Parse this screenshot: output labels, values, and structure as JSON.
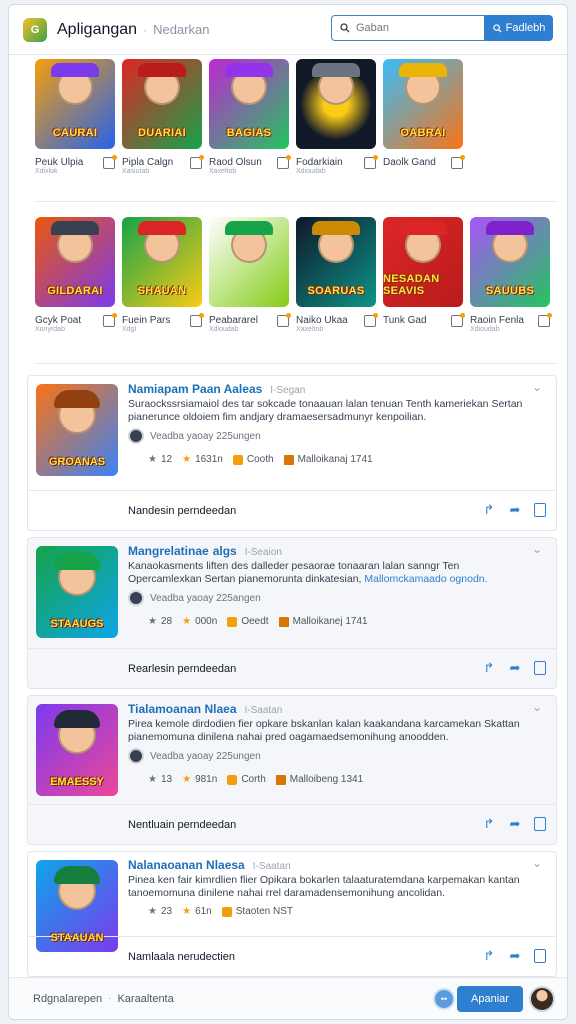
{
  "header": {
    "logo_text": "G",
    "app_title": "Apligangan",
    "separator": "·",
    "subtitle": "Nedarkan",
    "search_placeholder": "Gaban",
    "search_button": "Fadlebh"
  },
  "grid_row_1": [
    {
      "banner": "CAURAI",
      "name": "Peuk Ulpia",
      "sub": "Xdixlok",
      "bg": "linear-gradient(135deg,#f59e0b,#2563eb)",
      "accent": "#7c3aed"
    },
    {
      "banner": "DUARIAI",
      "name": "Pipla Calgn",
      "sub": "Xasiutab",
      "bg": "linear-gradient(135deg,#dc2626,#16a34a)",
      "accent": "#b91c1c"
    },
    {
      "banner": "BAGIAS",
      "name": "Raod Olsun",
      "sub": "Xaxeltob",
      "bg": "linear-gradient(135deg,#c026d3,#22c55e)",
      "accent": "#9333ea"
    },
    {
      "banner": "",
      "name": "Fodarkiain",
      "sub": "Xdioudab",
      "bg": "radial-gradient(circle,#facc15 20%,#111827 60%)",
      "accent": "#6b7280"
    },
    {
      "banner": "OABRAI",
      "name": "Daolk Gand",
      "sub": "",
      "bg": "linear-gradient(135deg,#38bdf8,#f97316)",
      "accent": "#eab308"
    }
  ],
  "grid_row_2": [
    {
      "banner": "GILDARAI",
      "name": "Gcyk Poat",
      "sub": "Xonyrdab",
      "bg": "linear-gradient(135deg,#ea580c,#7c3aed)",
      "accent": "#374151"
    },
    {
      "banner": "SHAUAN",
      "name": "Fuein Pars",
      "sub": "Xdgl",
      "bg": "linear-gradient(135deg,#16a34a,#facc15)",
      "accent": "#dc2626"
    },
    {
      "banner": "",
      "name": "Peabararel",
      "sub": "Xdioudab",
      "bg": "linear-gradient(135deg,#ffffff,#84cc16)",
      "accent": "#16a34a"
    },
    {
      "banner": "SOARUAS",
      "name": "Naiko Ukaa",
      "sub": "Xaxeltob",
      "bg": "linear-gradient(135deg,#0f172a,#0d9488)",
      "accent": "#ca8a04"
    },
    {
      "banner": "NESADAN SEAVIS",
      "name": "Tunk Gad",
      "sub": "",
      "bg": "linear-gradient(135deg,#dc2626,#b91c1c)",
      "accent": "#dc2626"
    },
    {
      "banner": "SAUUBS",
      "name": "Raoin Fenla",
      "sub": "Xdioudab",
      "bg": "linear-gradient(135deg,#a855f7,#22c55e)",
      "accent": "#7e22ce"
    }
  ],
  "cards": [
    {
      "title": "Namiapam Paan Aaleas",
      "tag": "I-Segan",
      "desc": "Suraockssrsiamaiol des tar sokcade tonaauan lalan tenuan Tenth kameriekan Sertan pianerunce oldoiem fim andjary dramaesersadmunyr kenpoilian.",
      "desc_link": "",
      "author": "Veadba yaoay 225ungen",
      "stat_1": "12",
      "stat_2": "1631n",
      "stat_3": "Cooth",
      "stat_4": "Malloikanaj 1741",
      "footer": "Nandesin perndeedan",
      "banner": "GROANAS",
      "thumb_bg": "linear-gradient(135deg,#f97316,#3b82f6)",
      "hair": "#92400e"
    },
    {
      "title": "Mangrelatinae",
      "tag": "I-Seaion",
      "desc": "Kanaokasments liften des dalleder pesaorae tonaaran lalan sanngr Ten Opercamlexkan Sertan pianemorunta dinkatesian, ",
      "desc_link": "Mallomckamaado ognodn.",
      "author": "Veadba yaoay 225angen",
      "stat_1": "28",
      "stat_2": "000n",
      "stat_3": "Oeedt",
      "stat_4": "Malloikanej 1741",
      "footer": "Rearlesin perndeedan",
      "banner": "STAAUGS",
      "thumb_bg": "linear-gradient(135deg,#16a34a,#0ea5e9)",
      "hair": "#16a34a",
      "title_suffix": "algs"
    },
    {
      "title": "Tialamoanan Nlaea",
      "tag": "I-Saatan",
      "desc": "Pirea kemole dirdodien fier opkare bskanlan kalan kaakandana karcamekan Skattan pianemomuna dinilena nahai pred oagamaedsemonihung anoodden.",
      "desc_link": "",
      "author": "Veadba yaoay 225ungen",
      "stat_1": "13",
      "stat_2": "981n",
      "stat_3": "Corth",
      "stat_4": "Malloibeng 1341",
      "footer": "Nentluain perndeedan",
      "banner": "EMAESSY",
      "thumb_bg": "linear-gradient(135deg,#7c3aed,#ec4899)",
      "hair": "#1f2937"
    },
    {
      "title": "Nalanaoanan Nlaesa",
      "tag": "I-Saatan",
      "desc": "Pinea ken fair kimrdlien flier Opikara bokarlen talaaturatemdana karpemakan kantan tanoemomuna dinilene nahai rrel daramadensemonihung ancolidan.",
      "desc_link": "",
      "author": "",
      "stat_1": "23",
      "stat_2": "61n",
      "stat_3": "Staoten NST",
      "stat_4": "",
      "footer": "Namlaala nerudectien",
      "banner": "STAAUAN",
      "thumb_bg": "linear-gradient(135deg,#0ea5e9,#7c3aed)",
      "hair": "#15803d"
    }
  ],
  "bottom": {
    "crumb_1": "Rdgnalarepen",
    "separator": "·",
    "crumb_2": "Karaaltenta",
    "primary_button": "Apaniar"
  }
}
